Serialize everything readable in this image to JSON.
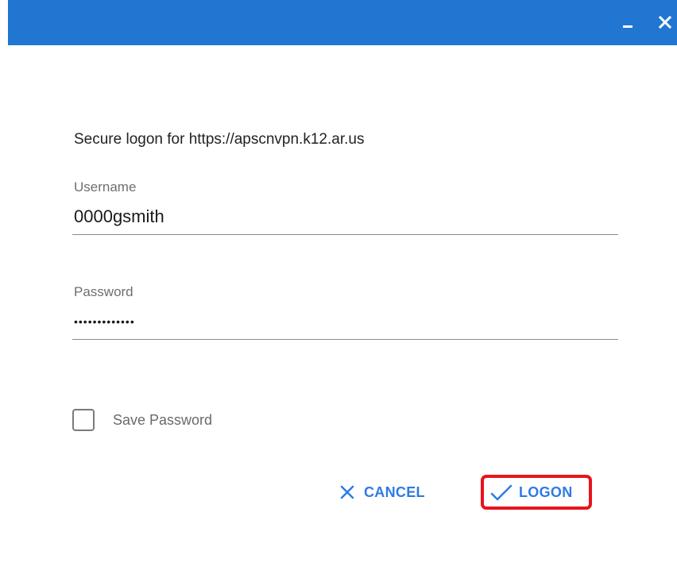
{
  "window": {
    "titlebar_color": "#2176d2",
    "minimize_icon": "minimize-icon",
    "close_icon": "close-icon"
  },
  "dialog": {
    "heading": "Secure logon for https://apscnvpn.k12.ar.us"
  },
  "username": {
    "label": "Username",
    "value": "0000gsmith"
  },
  "password": {
    "label": "Password",
    "value": "•••••••••••••"
  },
  "save_password": {
    "label": "Save Password",
    "checked": false
  },
  "buttons": {
    "cancel": {
      "label": "CANCEL",
      "icon": "close-x-icon"
    },
    "logon": {
      "label": "LOGON",
      "icon": "checkmark-icon",
      "highlight_color": "#e8141c"
    }
  },
  "colors": {
    "accent": "#2f7ae5"
  }
}
